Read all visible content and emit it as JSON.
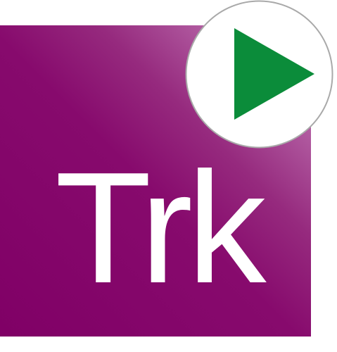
{
  "app_icon": {
    "label": "Trk",
    "badge_icon": "play-icon",
    "colors": {
      "tile_dark": "#800066",
      "tile_light": "#d4a3cc",
      "label": "#ffffff",
      "badge_fill": "#ffffff",
      "badge_border": "#a9a9a9",
      "play": "#0b8c3a"
    }
  }
}
